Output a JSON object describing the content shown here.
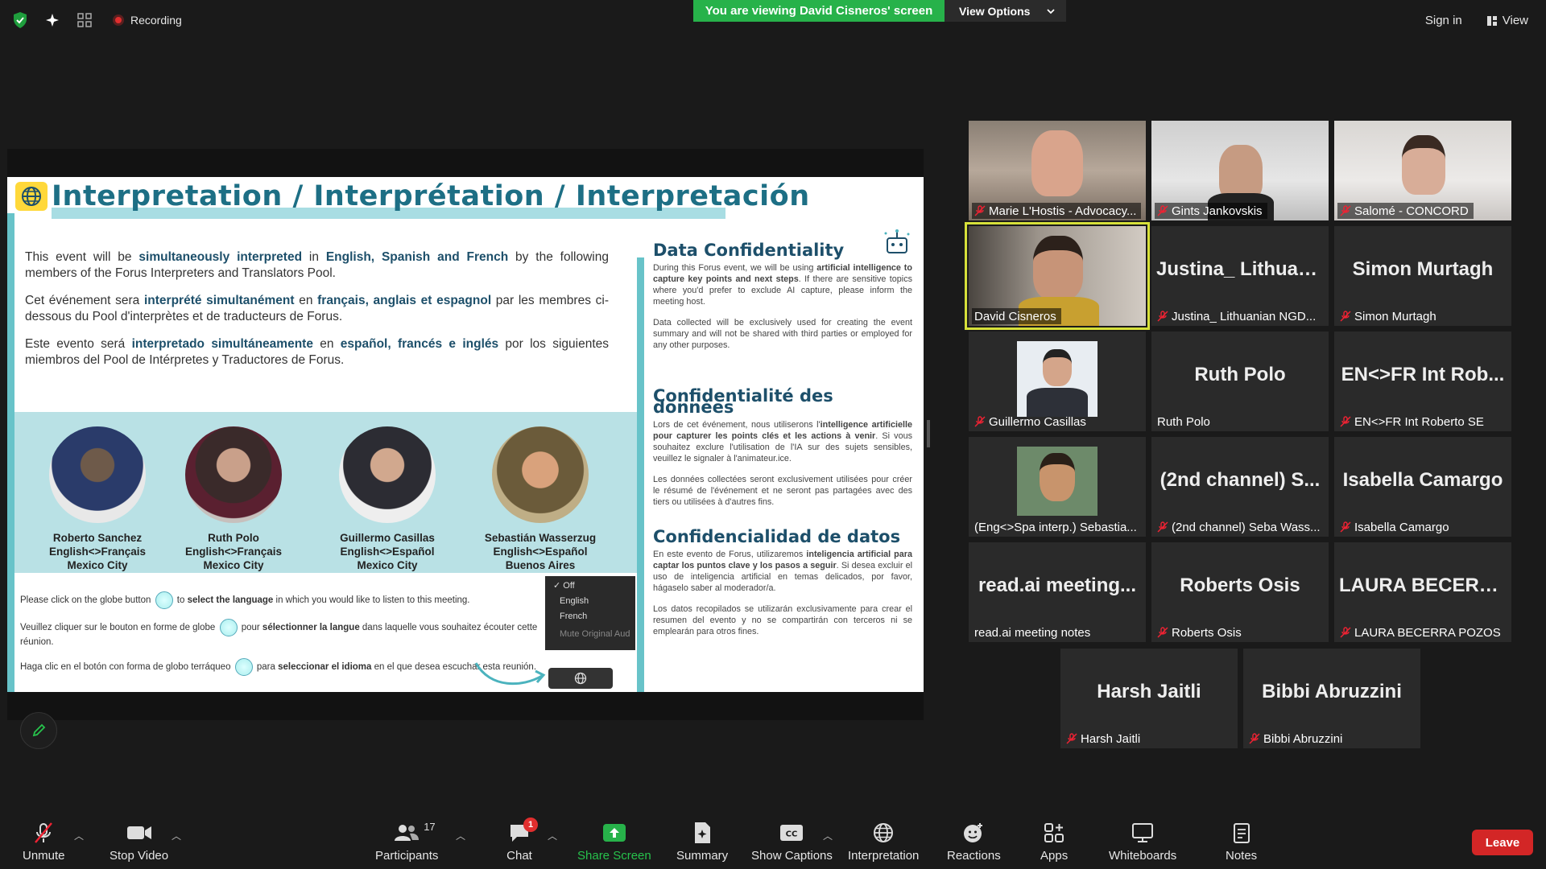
{
  "topbar": {
    "recording_label": "Recording",
    "viewing_banner": "You are viewing David Cisneros' screen",
    "view_options_label": "View Options",
    "sign_in_label": "Sign in",
    "view_label": "View"
  },
  "slide": {
    "title": "Interpretation / Interprétation / Interpretación",
    "intro": {
      "en": {
        "p1": "This event will be ",
        "b1": "simultaneously interpreted",
        "p2": " in ",
        "b2": "English, Spanish and French",
        "p3": " by the following members of the Forus Interpreters and Translators Pool."
      },
      "fr": {
        "p1": "Cet événement sera ",
        "b1": "interprété simultanément",
        "p2": " en ",
        "b2": "français, anglais et espagnol",
        "p3": " par les membres ci-dessous du Pool d'interprètes et de traducteurs de Forus."
      },
      "es": {
        "p1": "Este evento será ",
        "b1": "interpretado simultáneamente",
        "p2": " en ",
        "b2": "español, francés e inglés",
        "p3": " por los siguientes miembros del Pool de Intérpretes y Traductores de Forus."
      }
    },
    "interpreters": [
      {
        "name": "Roberto Sanchez",
        "pair": "English<>Français",
        "city": "Mexico City"
      },
      {
        "name": "Ruth Polo",
        "pair": "English<>Français",
        "city": "Mexico City"
      },
      {
        "name": "Guillermo Casillas",
        "pair": "English<>Español",
        "city": "Mexico City"
      },
      {
        "name": "Sebastián Wasserzug",
        "pair": "English<>Español",
        "city": "Buenos Aires"
      }
    ],
    "instructions": {
      "en": {
        "a": "Please click on the globe button ",
        "b": " to ",
        "bold": "select the language",
        "c": " in which you would like to listen to this meeting."
      },
      "fr": {
        "a": "Veuillez cliquer sur le bouton en forme de globe ",
        "b": " pour ",
        "bold": "sélectionner la langue",
        "c": " dans laquelle vous souhaitez écouter cette réunion."
      },
      "es": {
        "a": "Haga clic en el botón con forma de globo terráqueo ",
        "b": " para ",
        "bold": "seleccionar el idioma",
        "c": " en el que desea escuchar esta reunión."
      }
    },
    "language_menu": {
      "off": "✓ Off",
      "english": "English",
      "french": "French",
      "mute": "Mute Original Aud"
    },
    "confidentiality": {
      "en": {
        "heading": "Data Confidentiality",
        "p1a": "During this Forus event, we will be using ",
        "p1b": "artificial intelligence to capture key points and next steps",
        "p1c": ". If there are sensitive topics where you'd prefer to exclude AI capture, please inform the meeting host.",
        "p2": "Data collected will be exclusively used for creating the event summary and will not be shared with third parties or employed for any other purposes."
      },
      "fr": {
        "heading": "Confidentialité des données",
        "p1a": "Lors de cet événement, nous utiliserons l'",
        "p1b": "intelligence artificielle pour capturer les points clés et les actions à venir",
        "p1c": ". Si vous souhaitez exclure l'utilisation de l'IA sur des sujets sensibles, veuillez le signaler à l'animateur.ice.",
        "p2": "Les données collectées seront exclusivement utilisées pour créer le résumé de l'événement et ne seront pas partagées avec des tiers ou utilisées à d'autres fins."
      },
      "es": {
        "heading": "Confidencialidad de datos",
        "p1a": "En este evento de Forus, utilizaremos ",
        "p1b": "inteligencia artificial para captar los puntos clave y los pasos a seguir",
        "p1c": ". Si desea excluir el uso de inteligencia artificial en temas delicados, por favor, hágaselo saber al moderador/a.",
        "p2": "Los datos recopilados se utilizarán exclusivamente para crear el resumen del evento y no se compartirán con terceros ni se emplearán para otros fines."
      }
    }
  },
  "participants_tiles": [
    {
      "label": "Marie L'Hostis - Advocacy...",
      "video": true,
      "muted": true
    },
    {
      "label": "Gints Jankovskis",
      "video": true,
      "muted": true
    },
    {
      "label": "Salomé - CONCORD",
      "video": true,
      "muted": true
    },
    {
      "label": "David Cisneros",
      "video": true,
      "muted": false,
      "active": true
    },
    {
      "big": "Justina_ Lithuan...",
      "label": "Justina_ Lithuanian NGD...",
      "muted": true
    },
    {
      "big": "Simon Murtagh",
      "label": "Simon Murtagh",
      "muted": true
    },
    {
      "label": "Guillermo Casillas",
      "video": true,
      "muted": true
    },
    {
      "big": "Ruth Polo",
      "label": "Ruth Polo",
      "muted": false
    },
    {
      "big": "EN<>FR Int Rob...",
      "label": "EN<>FR Int Roberto SE",
      "muted": true
    },
    {
      "label": "(Eng<>Spa interp.) Sebastia...",
      "video": true,
      "muted": false
    },
    {
      "big": "(2nd channel) S...",
      "label": "(2nd channel) Seba Wass...",
      "muted": true
    },
    {
      "big": "Isabella Camargo",
      "label": "Isabella Camargo",
      "muted": true
    },
    {
      "big": "read.ai meeting...",
      "label": "read.ai meeting notes",
      "muted": false
    },
    {
      "big": "Roberts Osis",
      "label": "Roberts Osis",
      "muted": true
    },
    {
      "big": "LAURA BECERR...",
      "label": "LAURA BECERRA POZOS",
      "muted": true
    },
    {
      "big": "Harsh Jaitli",
      "label": "Harsh Jaitli",
      "muted": true
    },
    {
      "big": "Bibbi Abruzzini",
      "label": "Bibbi Abruzzini",
      "muted": true
    }
  ],
  "toolbar": {
    "unmute": "Unmute",
    "stop_video": "Stop Video",
    "participants": "Participants",
    "participants_count": "17",
    "chat": "Chat",
    "chat_badge": "1",
    "share_screen": "Share Screen",
    "summary": "Summary",
    "show_captions": "Show Captions",
    "interpretation": "Interpretation",
    "reactions": "Reactions",
    "apps": "Apps",
    "whiteboards": "Whiteboards",
    "notes": "Notes",
    "leave": "Leave"
  },
  "colors": {
    "share_green": "#27b24a",
    "leave_red": "#d32626",
    "active_speaker": "#d6e03a",
    "slide_teal": "#1d6f85"
  }
}
